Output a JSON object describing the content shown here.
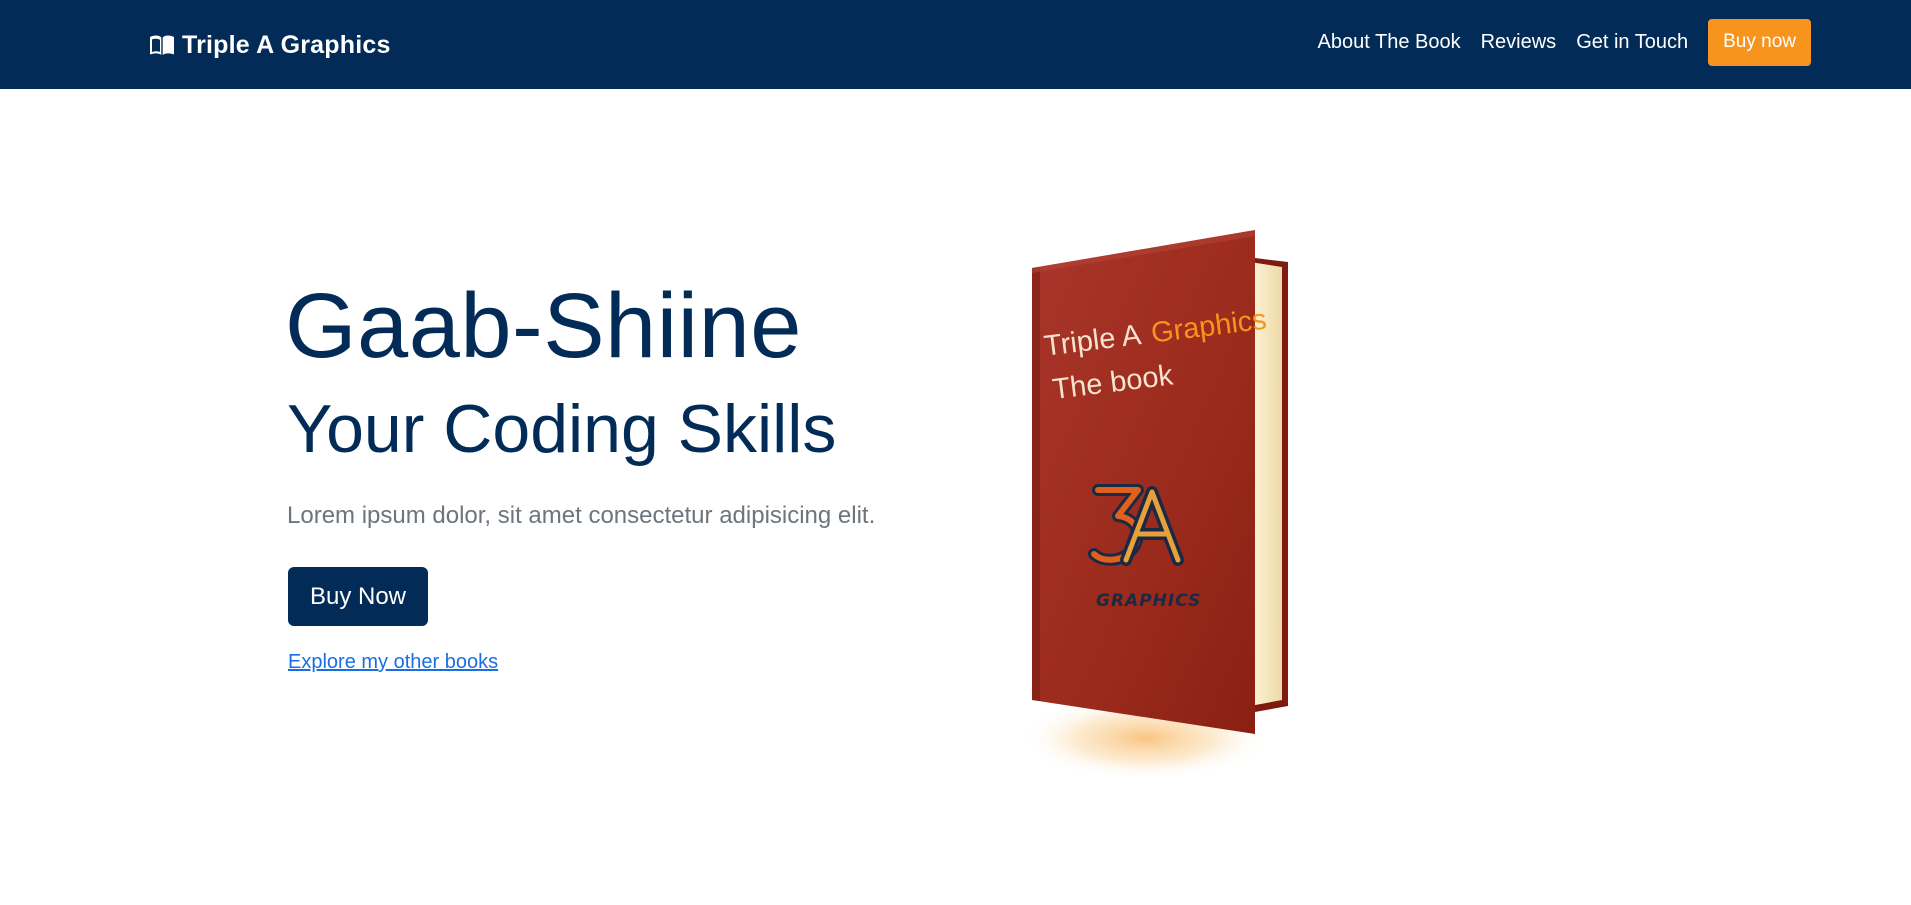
{
  "navbar": {
    "brand": "Triple A Graphics",
    "brand_icon": "book-open-icon",
    "links": [
      "About The Book",
      "Reviews",
      "Get in Touch"
    ],
    "cta": "Buy now",
    "background": "#022c57",
    "cta_color": "#f7941d"
  },
  "hero": {
    "title": "Gaab-Shiine",
    "subtitle": "Your Coding Skills",
    "lead": "Lorem ipsum dolor, sit amet consectetur adipisicing elit.",
    "button": "Buy Now",
    "link": "Explore my other books",
    "text_color": "#022c57"
  },
  "book": {
    "cover_line1_a": "Triple A",
    "cover_line1_b": "Graphics",
    "cover_line2": "The book",
    "logo_mark": "3A",
    "logo_word": "GRAPHICS",
    "cover_color": "#a0281c",
    "accent_color": "#f7941d"
  }
}
